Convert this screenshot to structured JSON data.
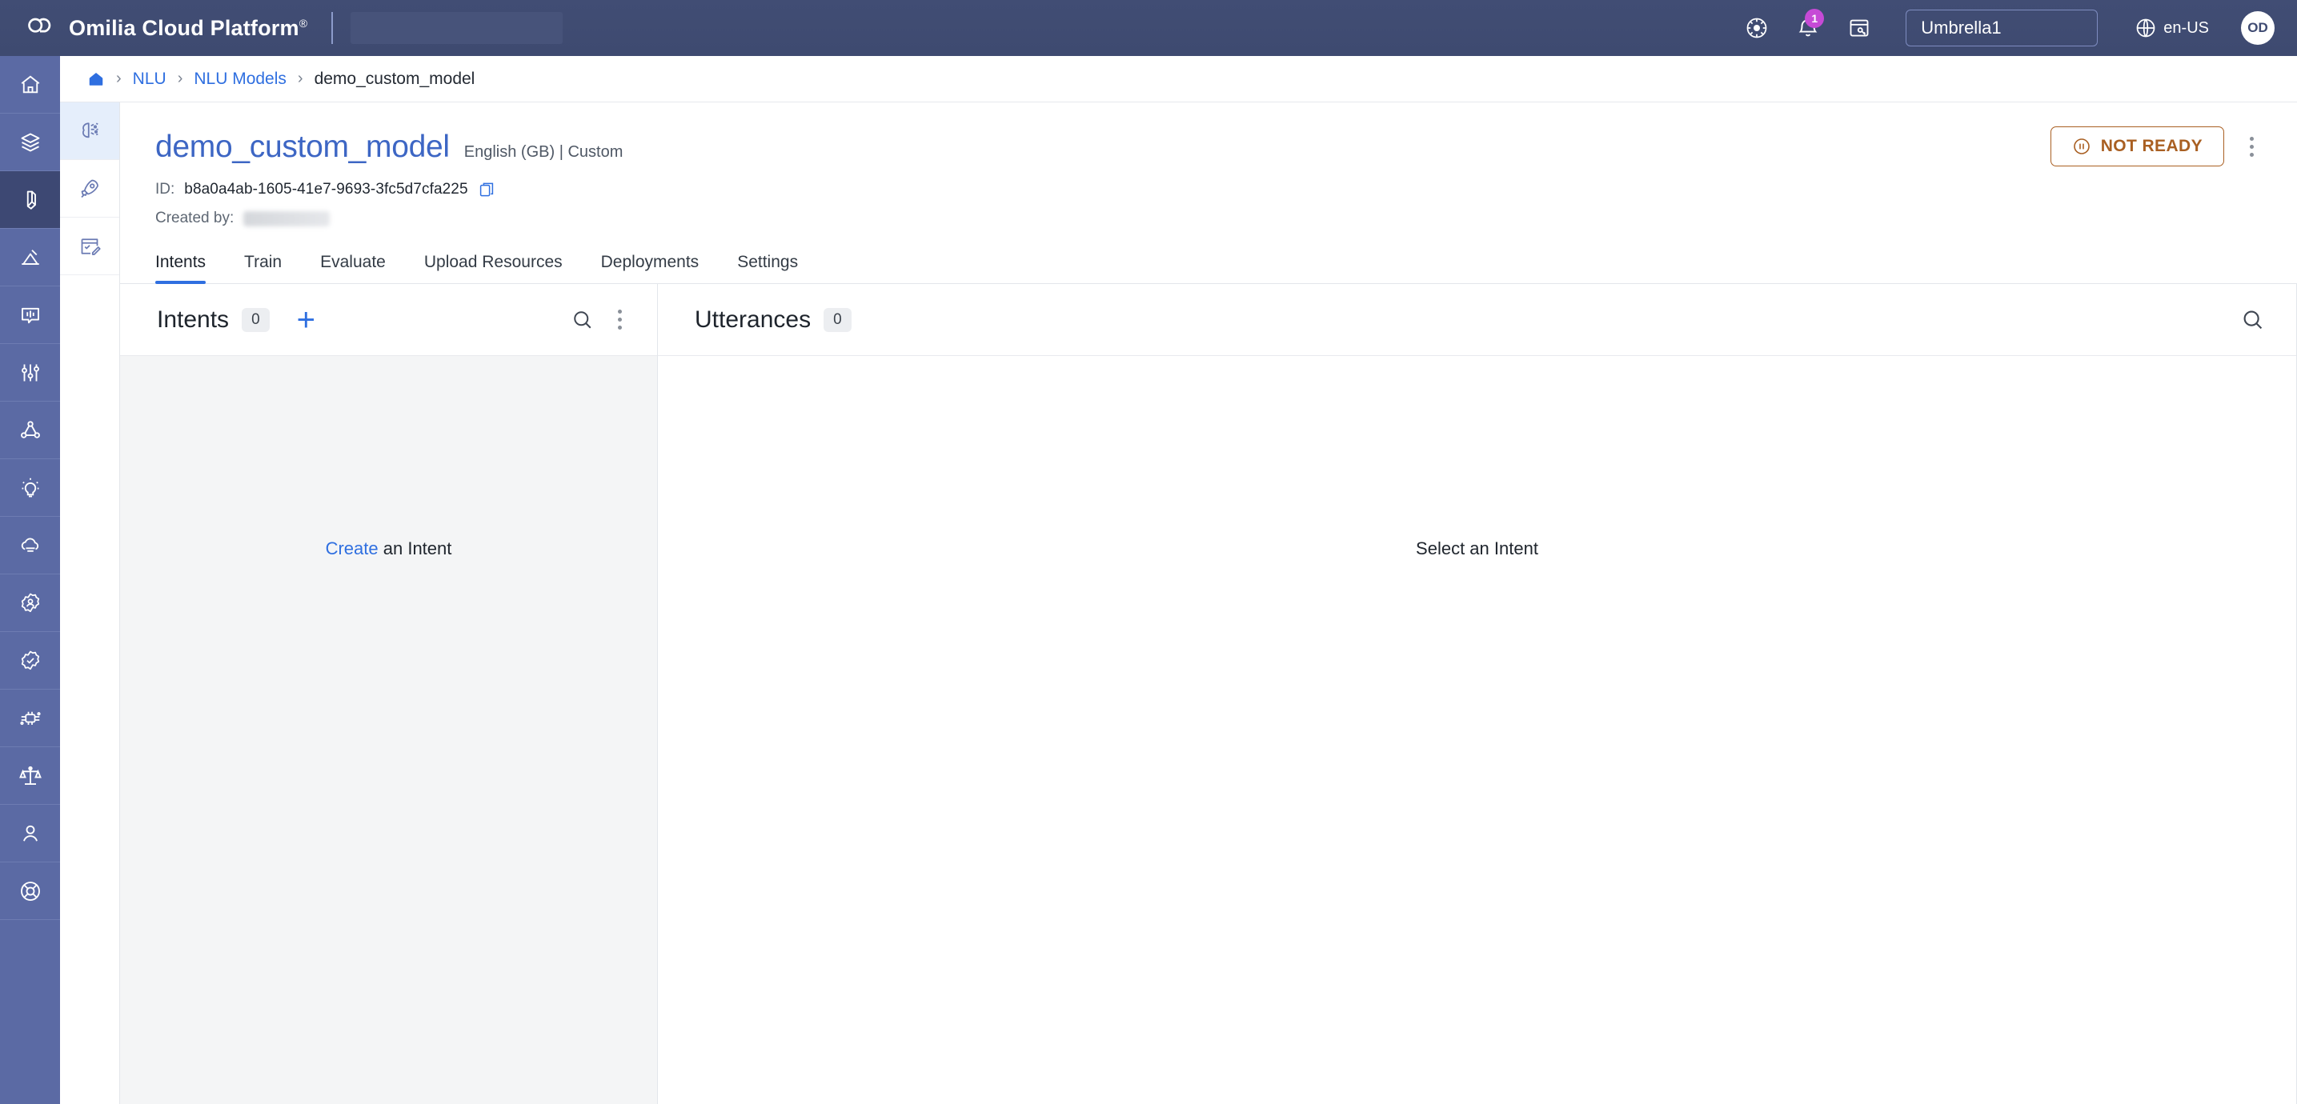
{
  "topbar": {
    "logo_icon": "omilia-cloud-logo",
    "brand": "Omilia Cloud Platform",
    "brand_mark": "®",
    "icons": {
      "theme": "brightness-icon",
      "notifications": "bell-icon",
      "notes": "note-key-icon",
      "globe": "globe-icon"
    },
    "notification_count": "1",
    "tenant_value": "Umbrella1",
    "tenant_placeholder": "Umbrella1",
    "language": "en-US",
    "avatar_initials": "OD"
  },
  "rail": {
    "items": [
      {
        "name": "home",
        "icon": "home-icon",
        "active": false
      },
      {
        "name": "stacks",
        "icon": "layers-icon",
        "active": false
      },
      {
        "name": "nlu",
        "icon": "nlu-probe-icon",
        "active": true
      },
      {
        "name": "analytics",
        "icon": "analytics-icon",
        "active": false
      },
      {
        "name": "voice",
        "icon": "speech-waveform-icon",
        "active": false
      },
      {
        "name": "tuning",
        "icon": "sliders-icon",
        "active": false
      },
      {
        "name": "flows",
        "icon": "nodes-graph-icon",
        "active": false
      },
      {
        "name": "insights",
        "icon": "lightbulb-icon",
        "active": false
      },
      {
        "name": "cloud",
        "icon": "cloud-icon",
        "active": false
      },
      {
        "name": "identity",
        "icon": "badge-person-icon",
        "active": false
      },
      {
        "name": "verification",
        "icon": "badge-check-icon",
        "active": false
      },
      {
        "name": "integrations",
        "icon": "circuit-icon",
        "active": false
      },
      {
        "name": "compliance",
        "icon": "scales-icon",
        "active": false
      },
      {
        "name": "users",
        "icon": "person-icon",
        "active": false
      },
      {
        "name": "support",
        "icon": "lifebuoy-icon",
        "active": false
      }
    ]
  },
  "subrail": {
    "items": [
      {
        "name": "nlu-models",
        "icon": "brain-icon",
        "active": true
      },
      {
        "name": "deployments",
        "icon": "rocket-icon",
        "active": false
      },
      {
        "name": "annotations",
        "icon": "checklist-edit-icon",
        "active": false
      }
    ]
  },
  "breadcrumb": {
    "home_icon": "home-icon",
    "separator": "›",
    "items": [
      {
        "label": "NLU",
        "link": true
      },
      {
        "label": "NLU Models",
        "link": true
      },
      {
        "label": "demo_custom_model",
        "link": false
      }
    ]
  },
  "page": {
    "title": "demo_custom_model",
    "subtitle": "English (GB) | Custom",
    "id_label": "ID:",
    "id_value": "b8a0a4ab-1605-41e7-9693-3fc5d7cfa225",
    "copy_icon": "copy-icon",
    "created_by_label": "Created by:",
    "created_by_value": "",
    "status": {
      "label": "NOT READY",
      "icon": "pause-circle-icon",
      "color": "#a95f22"
    },
    "menu_icon": "kebab-menu-icon"
  },
  "tabs": [
    {
      "label": "Intents",
      "active": true
    },
    {
      "label": "Train",
      "active": false
    },
    {
      "label": "Evaluate",
      "active": false
    },
    {
      "label": "Upload Resources",
      "active": false
    },
    {
      "label": "Deployments",
      "active": false
    },
    {
      "label": "Settings",
      "active": false
    }
  ],
  "intents_panel": {
    "title": "Intents",
    "count": "0",
    "add_icon": "plus-icon",
    "search_icon": "search-icon",
    "menu_icon": "kebab-menu-icon",
    "empty_link": "Create",
    "empty_rest": " an Intent"
  },
  "utterances_panel": {
    "title": "Utterances",
    "count": "0",
    "search_icon": "search-icon",
    "empty_text": "Select an Intent"
  },
  "colors": {
    "topbar": "#414d74",
    "rail": "#5b6aa4",
    "rail_active": "#3d4873",
    "accent_blue": "#2f6fe0",
    "title_blue": "#3d66c4",
    "badge_magenta": "#c64ad6",
    "status_orange": "#a95f22",
    "panel_grey": "#f4f5f6"
  }
}
